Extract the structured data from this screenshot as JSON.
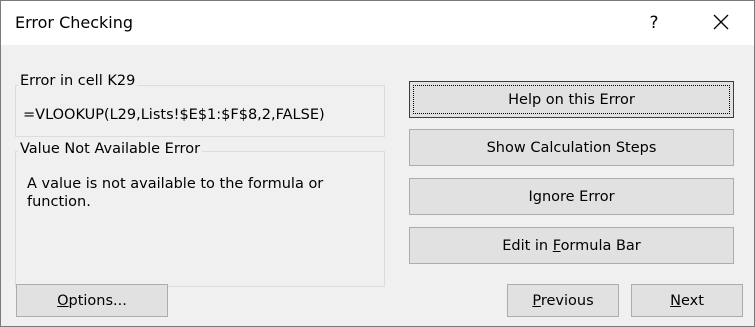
{
  "dialog": {
    "title": "Error Checking",
    "help_glyph": "?",
    "close_icon": "close-icon"
  },
  "error_group": {
    "legend": "Error in cell K29",
    "formula": "=VLOOKUP(L29,Lists!$E$1:$F$8,2,FALSE)"
  },
  "info_group": {
    "legend": "Value Not Available Error",
    "description": "A value is not available to the formula or function."
  },
  "buttons": {
    "help_on_error": "Help on this Error",
    "show_calc_steps": "Show Calculation Steps",
    "ignore_error": "Ignore Error",
    "edit_formula_bar": {
      "pre": "Edit in ",
      "accel": "F",
      "post": "ormula Bar"
    },
    "options": {
      "accel": "O",
      "post": "ptions..."
    },
    "previous": {
      "accel": "P",
      "post": "revious"
    },
    "next": {
      "accel": "N",
      "post": "ext"
    }
  }
}
